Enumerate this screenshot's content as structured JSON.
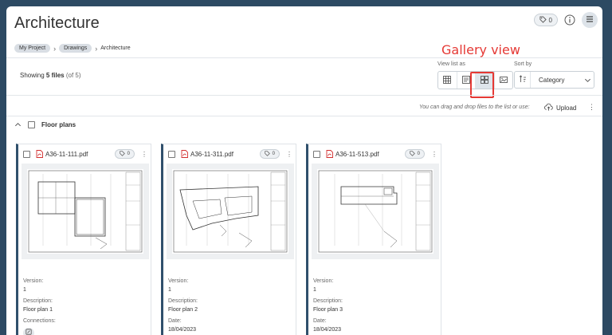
{
  "header": {
    "title": "Architecture",
    "tag_count": "0"
  },
  "breadcrumb": {
    "items": [
      "My Project",
      "Drawings"
    ],
    "current": "Architecture"
  },
  "toolbar": {
    "showing_prefix": "Showing",
    "showing_count": "5 files",
    "showing_total": "(of 5)",
    "view_list_label": "View list as",
    "view_modes": [
      "table",
      "list",
      "gallery",
      "image"
    ],
    "active_view": "gallery",
    "sort_label": "Sort by",
    "sort_value": "Category",
    "annotation": "Gallery view",
    "drag_hint": "You can drag and drop files to the list or use:",
    "upload_label": "Upload"
  },
  "group": {
    "label": "Floor plans"
  },
  "files": [
    {
      "name": "A36-11-111.pdf",
      "tag_count": "0",
      "version_label": "Version:",
      "version": "1",
      "description_label": "Description:",
      "description": "Floor plan 1",
      "extra_label": "Connections:",
      "extra_value": ""
    },
    {
      "name": "A36-11-311.pdf",
      "tag_count": "0",
      "version_label": "Version:",
      "version": "1",
      "description_label": "Description:",
      "description": "Floor plan 2",
      "extra_label": "Date:",
      "extra_value": "18/04/2023"
    },
    {
      "name": "A36-11-513.pdf",
      "tag_count": "0",
      "version_label": "Version:",
      "version": "1",
      "description_label": "Description:",
      "description": "Floor plan 3",
      "extra_label": "Date:",
      "extra_value": "18/04/2023"
    }
  ],
  "colors": {
    "accent": "#30506c",
    "highlight": "#e53935",
    "pdf": "#d32f2f"
  }
}
